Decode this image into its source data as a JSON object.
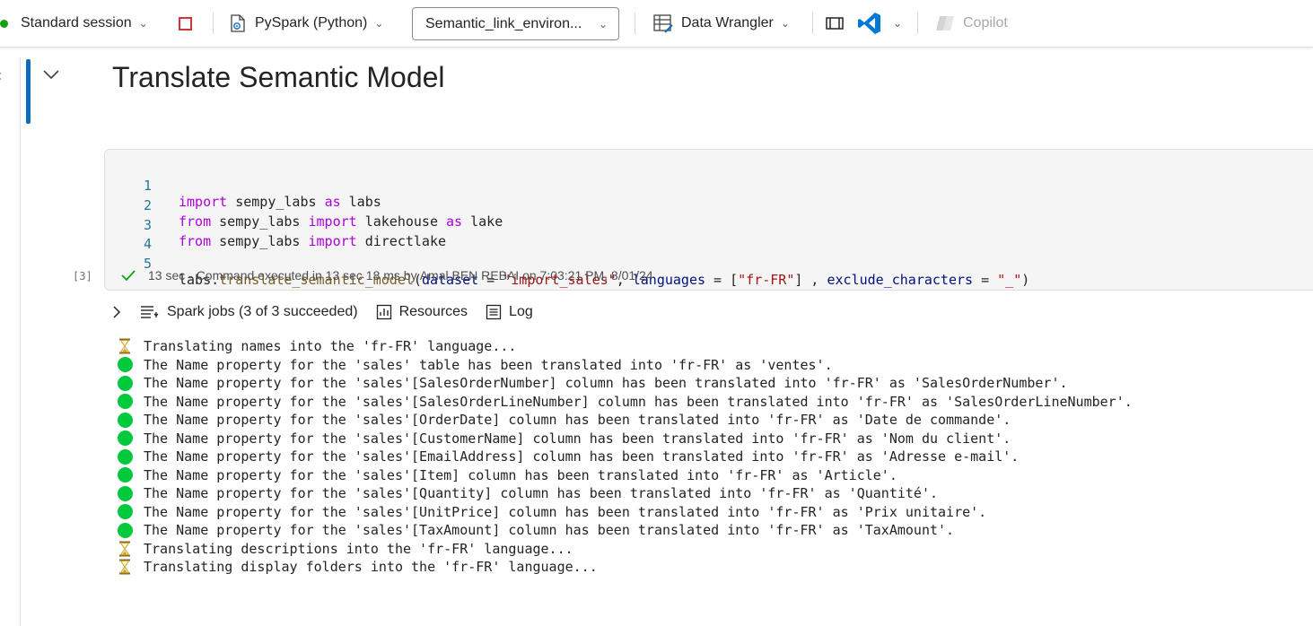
{
  "toolbar": {
    "session_label": "Standard session",
    "language_label": "PySpark (Python)",
    "environment_label": "Semantic_link_environ...",
    "data_wrangler_label": "Data Wrangler",
    "copilot_label": "Copilot"
  },
  "notebook": {
    "markdown_title": "Translate Semantic Model",
    "code_cell": {
      "execution_count": "[3]",
      "line_numbers": [
        "1",
        "2",
        "3",
        "4",
        "5"
      ],
      "status": "13 sec - Command executed in 13 sec 18 ms by Amal BEN REBAI on 7:03:21 PM, 8/01/24"
    },
    "output_bar": {
      "spark_jobs": "Spark jobs (3 of 3 succeeded)",
      "resources": "Resources",
      "log": "Log"
    },
    "output_lines": [
      "Translating names into the 'fr-FR' language...",
      "The Name property for the 'sales' table has been translated into 'fr-FR' as 'ventes'.",
      "The Name property for the 'sales'[SalesOrderNumber] column has been translated into 'fr-FR' as 'SalesOrderNumber'.",
      "The Name property for the 'sales'[SalesOrderLineNumber] column has been translated into 'fr-FR' as 'SalesOrderLineNumber'.",
      "The Name property for the 'sales'[OrderDate] column has been translated into 'fr-FR' as 'Date de commande'.",
      "The Name property for the 'sales'[CustomerName] column has been translated into 'fr-FR' as 'Nom du client'.",
      "The Name property for the 'sales'[EmailAddress] column has been translated into 'fr-FR' as 'Adresse e-mail'.",
      "The Name property for the 'sales'[Item] column has been translated into 'fr-FR' as 'Article'.",
      "The Name property for the 'sales'[Quantity] column has been translated into 'fr-FR' as 'Quantité'.",
      "The Name property for the 'sales'[UnitPrice] column has been translated into 'fr-FR' as 'Prix unitaire'.",
      "The Name property for the 'sales'[TaxAmount] column has been translated into 'fr-FR' as 'TaxAmount'.",
      "Translating descriptions into the 'fr-FR' language...",
      "Translating display folders into the 'fr-FR' language..."
    ]
  },
  "code": {
    "l1": {
      "kw_import": "import",
      "mod": " sempy_labs ",
      "kw_as": "as",
      "alias": " labs"
    },
    "l2": {
      "kw_from": "from",
      "mod": " sempy_labs ",
      "kw_import": "import",
      "name": " lakehouse ",
      "kw_as": "as",
      "alias": " lake"
    },
    "l3": {
      "kw_from": "from",
      "mod": " sempy_labs ",
      "kw_import": "import",
      "name": " directlake"
    },
    "l5": {
      "obj": "labs.",
      "fn": "translate_semantic_model",
      "open": "(",
      "p1": "dataset",
      "eq1": " = ",
      "s1": "\"import_sales\"",
      "c1": ", ",
      "p2": "languages",
      "eq2": " = [",
      "s2": "\"fr-FR\"",
      "c2": "] , ",
      "p3": "exclude_characters",
      "eq3": " = ",
      "s3": "\"_\"",
      "close": ")"
    }
  },
  "colors": {
    "accent": "#0f6cbd",
    "session_status": "#13a10e",
    "stop": "#d13438",
    "success_dot": "#00c93c",
    "hourglass": "#c9a227"
  },
  "icons": {
    "output_line_icons": [
      "hourglass-icon",
      "status-dot-icon",
      "status-dot-icon",
      "status-dot-icon",
      "status-dot-icon",
      "status-dot-icon",
      "status-dot-icon",
      "status-dot-icon",
      "status-dot-icon",
      "status-dot-icon",
      "status-dot-icon",
      "hourglass-icon",
      "hourglass-icon"
    ]
  }
}
